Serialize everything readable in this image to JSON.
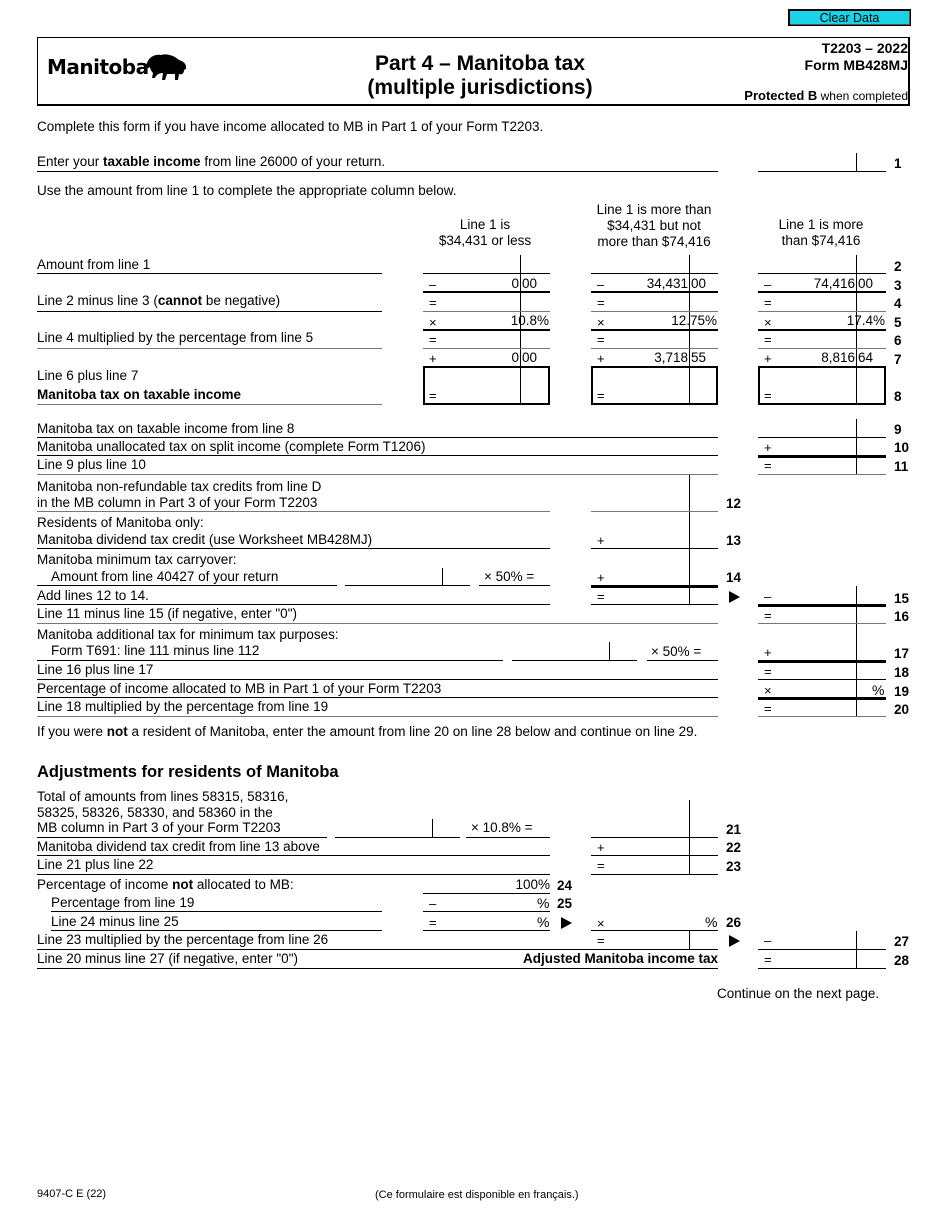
{
  "toolbar": {
    "clear_label": "Clear Data"
  },
  "header": {
    "logo_text": "Manitoba",
    "title_line1": "Part 4 – Manitoba tax",
    "title_line2": "(multiple jurisdictions)",
    "form_year": "T2203 – 2022",
    "form_code": "Form MB428MJ",
    "protected_bold": "Protected B",
    "protected_rest": " when completed"
  },
  "intro": "Complete this form if you have income allocated to MB in Part 1 of your Form T2203.",
  "line1": {
    "pre": "Enter your ",
    "bold": "taxable income",
    "post": " from line 26000 of your return.",
    "num": "1"
  },
  "use_amount": "Use the amount from line 1 to complete the appropriate column below.",
  "columns": [
    {
      "head1": "Line 1 is",
      "head2": "$34,431 or less",
      "line3_dollars": "0",
      "line3_cents": "00",
      "line5": "10.8%",
      "line7_dollars": "0",
      "line7_cents": "00"
    },
    {
      "head0": "Line 1 is more than",
      "head1": "$34,431 but not",
      "head2": "more than $74,416",
      "line3_dollars": "34,431",
      "line3_cents": "00",
      "line5": "12.75%",
      "line7_dollars": "3,718",
      "line7_cents": "55"
    },
    {
      "head1": "Line 1 is more",
      "head2": "than $74,416",
      "line3_dollars": "74,416",
      "line3_cents": "00",
      "line5": "17.4%",
      "line7_dollars": "8,816",
      "line7_cents": "64"
    }
  ],
  "ops": {
    "minus": "–",
    "equals": "=",
    "times": "×",
    "plus": "+",
    "percent": "%"
  },
  "lines": {
    "l2": "Amount from line 1",
    "l4_pre": "Line 2 minus line 3 (",
    "l4_bold": "cannot",
    "l4_post": " be negative)",
    "l6": "Line 4 multiplied by the percentage from line 5",
    "l8a": "Line 6 plus line 7",
    "l8b": "Manitoba tax on taxable income",
    "l9": "Manitoba tax on taxable income from line 8",
    "l10": "Manitoba unallocated tax on split income (complete Form T1206)",
    "l11": "Line 9 plus line 10",
    "l12a": "Manitoba non-refundable tax credits from line D",
    "l12b": "in the MB column in Part 3 of your Form T2203",
    "l13a": "Residents of Manitoba only:",
    "l13b": "Manitoba dividend tax credit (use Worksheet MB428MJ)",
    "l14a": "Manitoba minimum tax carryover:",
    "l14b": "Amount from line 40427 of your return",
    "x50": "× 50% =",
    "l15": "Add lines 12 to 14.",
    "l16": "Line 11 minus line 15 (if negative, enter \"0\")",
    "l17a": "Manitoba additional tax for minimum tax purposes:",
    "l17b": "Form T691: line 111 minus line 112",
    "l18": "Line 16 plus line 17",
    "l19": "Percentage of income allocated to MB in Part 1 of your Form T2203",
    "l20": "Line 18 multiplied by the percentage from line 19",
    "nonres_pre": "If you were ",
    "nonres_bold": "not",
    "nonres_post": " a resident of Manitoba, enter the amount from line 20 on line 28 below and continue on line 29.",
    "adj_heading": "Adjustments for residents of Manitoba",
    "l21a": "Total of amounts from lines 58315, 58316,",
    "l21b": "58325, 58326, 58330, and 58360 in the",
    "l21c": "MB column in Part 3 of your Form T2203",
    "x108": "× 10.8% =",
    "l22": "Manitoba dividend tax credit from line 13 above",
    "l23": "Line 21 plus line 22",
    "l24_pre": "Percentage of income ",
    "l24_bold": "not",
    "l24_post": " allocated to MB:",
    "l24_val": "100%",
    "l25": "Percentage from line 19",
    "l26": "Line 24 minus line 25",
    "l27": "Line 23 multiplied by the percentage from line 26",
    "l28": "Line 20 minus line 27 (if negative, enter \"0\")",
    "l28_label": "Adjusted Manitoba income tax"
  },
  "line_numbers": [
    "1",
    "2",
    "3",
    "4",
    "5",
    "6",
    "7",
    "8",
    "9",
    "10",
    "11",
    "12",
    "13",
    "14",
    "15",
    "16",
    "17",
    "18",
    "19",
    "20",
    "21",
    "22",
    "23",
    "24",
    "25",
    "26",
    "27",
    "28"
  ],
  "continue": "Continue on the next page.",
  "footer": {
    "code": "9407-C E (22)",
    "french": "(Ce formulaire est disponible en français.)"
  }
}
